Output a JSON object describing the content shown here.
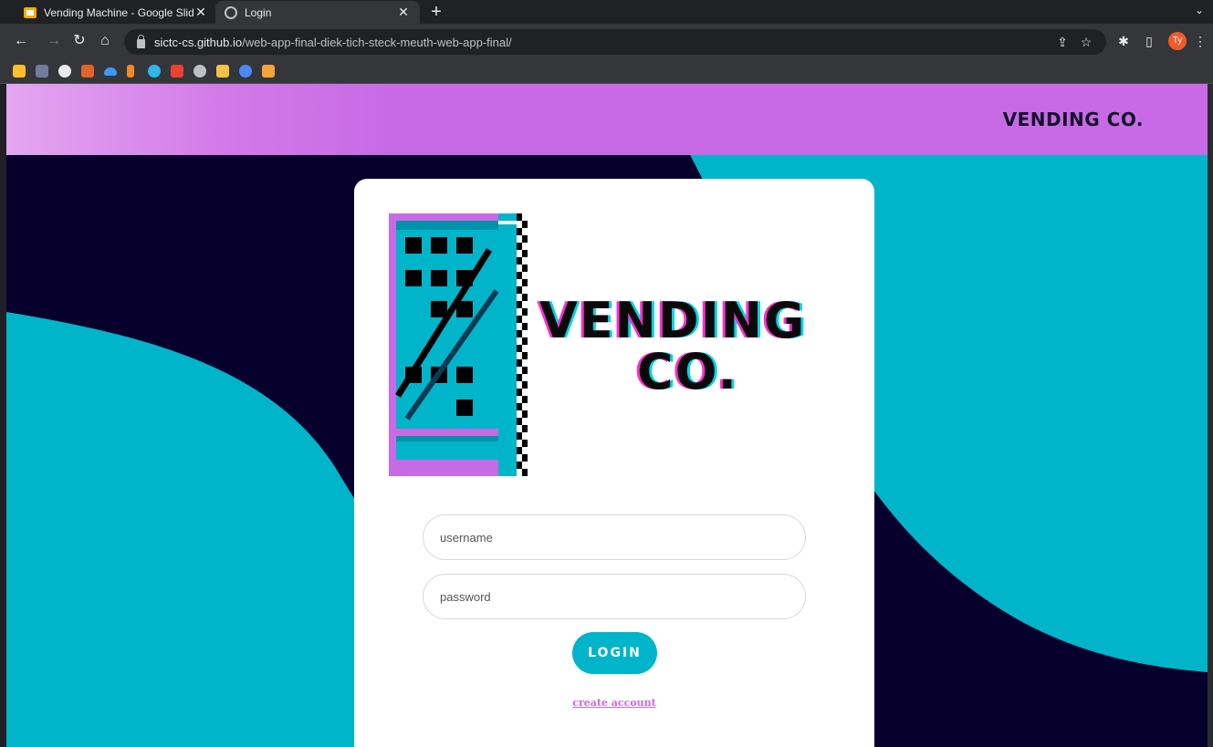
{
  "browser": {
    "tabs": [
      {
        "label": "Vending Machine - Google Slid",
        "active": false
      },
      {
        "label": "Login",
        "active": true
      }
    ],
    "address": {
      "host": "sictc-cs.github.io",
      "path": "/web-app-final-diek-tich-steck-meuth-web-app-final/"
    },
    "profile_initials": "Ty",
    "bookmark_colors": [
      "#f9c02b",
      "#6e7ea0",
      "#e8eaed",
      "#e2632b",
      "#3b9af2",
      "#f28a2b",
      "#2fb7ea",
      "#e94235",
      "#bdc1c6",
      "#f5c24a",
      "#4a8af4",
      "#f4a53a"
    ]
  },
  "site": {
    "brand": "VENDING CO.",
    "logo_line1": "VENDING",
    "logo_line2": "CO.",
    "colors": {
      "purple": "#c86ae6",
      "teal": "#00b5c9",
      "navy": "#07002d"
    }
  },
  "login_form": {
    "username_placeholder": "username",
    "password_placeholder": "password",
    "login_label": "LOGIN",
    "create_account_label": "create account"
  }
}
